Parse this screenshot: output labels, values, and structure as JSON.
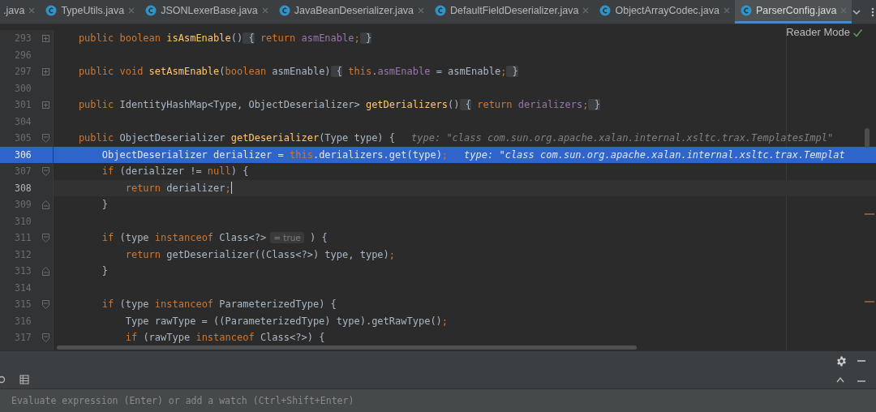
{
  "tabs": [
    {
      "label": ".java",
      "selected": false,
      "has_icon": false
    },
    {
      "label": "TypeUtils.java",
      "selected": false,
      "has_icon": true
    },
    {
      "label": "JSONLexerBase.java",
      "selected": false,
      "has_icon": true
    },
    {
      "label": "JavaBeanDeserializer.java",
      "selected": false,
      "has_icon": true
    },
    {
      "label": "DefaultFieldDeserializer.java",
      "selected": false,
      "has_icon": true
    },
    {
      "label": "ObjectArrayCodec.java",
      "selected": false,
      "has_icon": true
    },
    {
      "label": "ParserConfig.java",
      "selected": true,
      "has_icon": true
    }
  ],
  "reader_mode": "Reader Mode",
  "lines": [
    {
      "number": "293",
      "selected": false,
      "current": false,
      "fold": {
        "kind": "collapsed"
      },
      "tokens": [
        {
          "kind": "kw",
          "text": "    public"
        },
        {
          "kind": "kw",
          "text": " boolean"
        },
        {
          "kind": "fn",
          "text": " isAsmEnable"
        },
        {
          "kind": "pl",
          "text": "()"
        },
        {
          "kind": "folded",
          "text": " {"
        },
        {
          "kind": "kw",
          "text": " return"
        },
        {
          "kind": "field",
          "text": " asmEnable"
        },
        {
          "kind": "kw",
          "text": ";"
        },
        {
          "kind": "folded",
          "text": " }"
        }
      ]
    },
    {
      "number": "296",
      "selected": false,
      "current": false
    },
    {
      "number": "297",
      "selected": false,
      "current": false,
      "fold": {
        "kind": "collapsed"
      },
      "tokens": [
        {
          "kind": "kw",
          "text": "    public"
        },
        {
          "kind": "kw",
          "text": " void"
        },
        {
          "kind": "fn",
          "text": " setAsmEnable"
        },
        {
          "kind": "pl",
          "text": "("
        },
        {
          "kind": "kw",
          "text": "boolean"
        },
        {
          "kind": "pl",
          "text": " asmEnable)"
        },
        {
          "kind": "folded",
          "text": " {"
        },
        {
          "kind": "kw",
          "text": " this"
        },
        {
          "kind": "pl",
          "text": "."
        },
        {
          "kind": "field",
          "text": "asmEnable"
        },
        {
          "kind": "pl",
          "text": " = asmEnable"
        },
        {
          "kind": "kw",
          "text": ";"
        },
        {
          "kind": "folded",
          "text": " }"
        }
      ]
    },
    {
      "number": "300",
      "selected": false,
      "current": false
    },
    {
      "number": "301",
      "selected": false,
      "current": false,
      "fold": {
        "kind": "collapsed"
      },
      "tokens": [
        {
          "kind": "kw",
          "text": "    public"
        },
        {
          "kind": "pl",
          "text": " IdentityHashMap<Type, ObjectDeserializer>"
        },
        {
          "kind": "fn",
          "text": " getDerializers"
        },
        {
          "kind": "pl",
          "text": "()"
        },
        {
          "kind": "folded",
          "text": " {"
        },
        {
          "kind": "kw",
          "text": " return"
        },
        {
          "kind": "field",
          "text": " derializers"
        },
        {
          "kind": "kw",
          "text": ";"
        },
        {
          "kind": "folded",
          "text": " }"
        }
      ]
    },
    {
      "number": "304",
      "selected": false,
      "current": false
    },
    {
      "number": "305",
      "selected": false,
      "current": false,
      "fold": {
        "kind": "open"
      },
      "tokens": [
        {
          "kind": "kw",
          "text": "    public"
        },
        {
          "kind": "pl",
          "text": " ObjectDeserializer"
        },
        {
          "kind": "fn",
          "text": " getDeserializer"
        },
        {
          "kind": "pl",
          "text": "(Type type) {"
        },
        {
          "kind": "hint",
          "text": "type: \"class com.sun.org.apache.xalan.internal.xsltc.trax.TemplatesImpl\""
        }
      ]
    },
    {
      "number": "306",
      "selected": true,
      "current": false,
      "tokens": [
        {
          "kind": "pl",
          "text": "        ObjectDeserializer derializer = "
        },
        {
          "kind": "kw",
          "text": "this"
        },
        {
          "kind": "pl",
          "text": "."
        },
        {
          "kind": "field",
          "text": "derializers"
        },
        {
          "kind": "pl",
          "text": ".get(type)"
        },
        {
          "kind": "kw",
          "text": ";"
        },
        {
          "kind": "hint",
          "text": "type: \"class com.sun.org.apache.xalan.internal.xsltc.trax.Templat"
        }
      ]
    },
    {
      "number": "307",
      "selected": false,
      "current": false,
      "fold": {
        "kind": "open"
      },
      "tokens": [
        {
          "kind": "kw",
          "text": "        if"
        },
        {
          "kind": "pl",
          "text": " (derializer != "
        },
        {
          "kind": "kw",
          "text": "null"
        },
        {
          "kind": "pl",
          "text": ") {"
        }
      ]
    },
    {
      "number": "308",
      "selected": false,
      "current": true,
      "tokens": [
        {
          "kind": "kw",
          "text": "            return"
        },
        {
          "kind": "pl",
          "text": " derializer"
        },
        {
          "kind": "kw",
          "text": ";"
        }
      ]
    },
    {
      "number": "309",
      "selected": false,
      "current": false,
      "fold": {
        "kind": "close"
      },
      "tokens": [
        {
          "kind": "pl",
          "text": "        }"
        }
      ]
    },
    {
      "number": "310",
      "selected": false,
      "current": false
    },
    {
      "number": "311",
      "selected": false,
      "current": false,
      "fold": {
        "kind": "open"
      },
      "tokens": [
        {
          "kind": "kw",
          "text": "        if"
        },
        {
          "kind": "pl",
          "text": " (type"
        },
        {
          "kind": "kw",
          "text": " instanceof"
        },
        {
          "kind": "pl",
          "text": " Class<?>"
        },
        {
          "kind": "inlay",
          "text": "= true"
        },
        {
          "kind": "pl",
          "text": " ) {"
        }
      ]
    },
    {
      "number": "312",
      "selected": false,
      "current": false,
      "tokens": [
        {
          "kind": "kw",
          "text": "            return"
        },
        {
          "kind": "pl",
          "text": " getDeserializer((Class<?>) type, type)"
        },
        {
          "kind": "kw",
          "text": ";"
        }
      ]
    },
    {
      "number": "313",
      "selected": false,
      "current": false,
      "fold": {
        "kind": "close"
      },
      "tokens": [
        {
          "kind": "pl",
          "text": "        }"
        }
      ]
    },
    {
      "number": "314",
      "selected": false,
      "current": false
    },
    {
      "number": "315",
      "selected": false,
      "current": false,
      "fold": {
        "kind": "open"
      },
      "tokens": [
        {
          "kind": "kw",
          "text": "        if"
        },
        {
          "kind": "pl",
          "text": " (type"
        },
        {
          "kind": "kw",
          "text": " instanceof"
        },
        {
          "kind": "pl",
          "text": " ParameterizedType) {"
        }
      ]
    },
    {
      "number": "316",
      "selected": false,
      "current": false,
      "tokens": [
        {
          "kind": "pl",
          "text": "            Type rawType = ((ParameterizedType) type).getRawType()"
        },
        {
          "kind": "kw",
          "text": ";"
        }
      ]
    },
    {
      "number": "317",
      "selected": false,
      "current": false,
      "fold": {
        "kind": "open"
      },
      "tokens": [
        {
          "kind": "kw",
          "text": "            if"
        },
        {
          "kind": "pl",
          "text": " (rawType"
        },
        {
          "kind": "kw",
          "text": " instanceof"
        },
        {
          "kind": "pl",
          "text": " Class<?>) {"
        }
      ]
    }
  ],
  "watch": {
    "placeholder": "Evaluate expression (Enter) or add a watch (Ctrl+Shift+Enter)"
  }
}
